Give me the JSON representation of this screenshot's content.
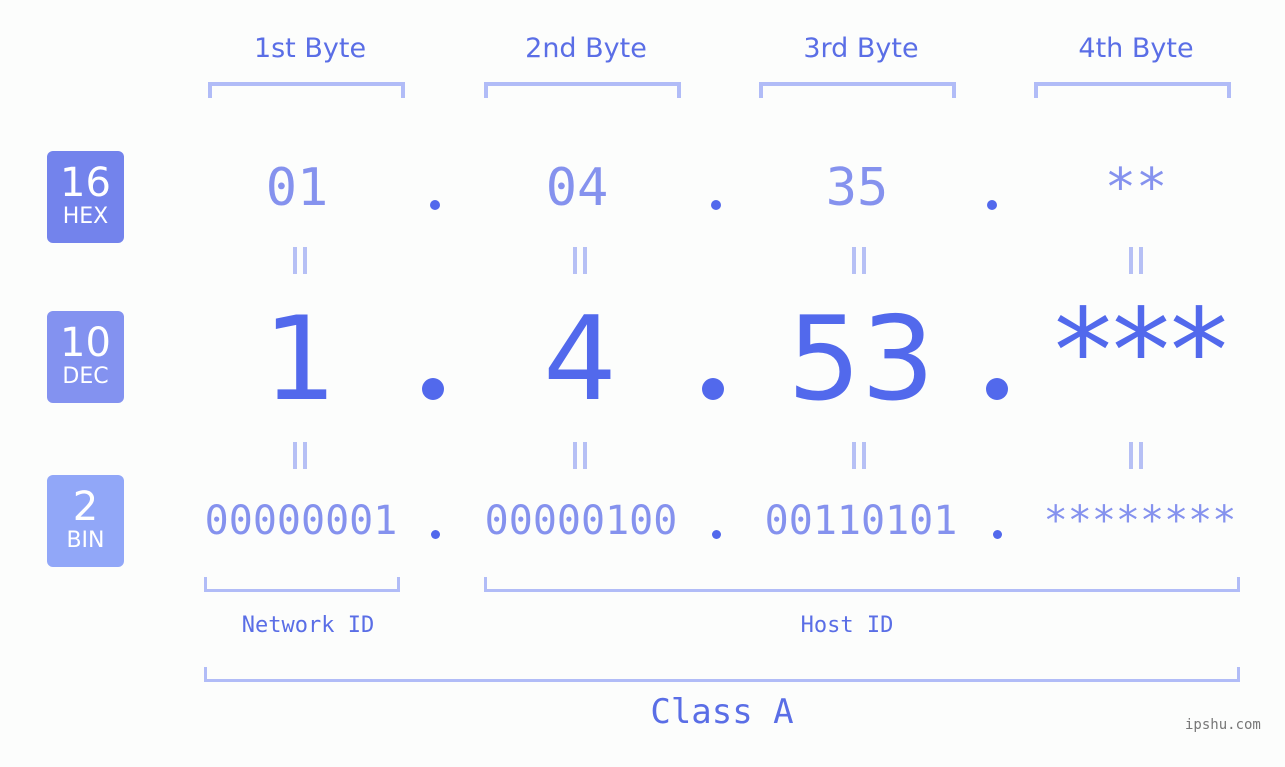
{
  "byte_headers": [
    "1st Byte",
    "2nd Byte",
    "3rd Byte",
    "4th Byte"
  ],
  "badges": [
    {
      "number": "16",
      "label": "HEX",
      "color": "#7383ec"
    },
    {
      "number": "10",
      "label": "DEC",
      "color": "#8392f0"
    },
    {
      "number": "2",
      "label": "BIN",
      "color": "#91a7f8"
    }
  ],
  "hex_values": [
    "01",
    "04",
    "35",
    "**"
  ],
  "dec_values": [
    "1",
    "4",
    "53",
    "***"
  ],
  "bin_values": [
    "00000001",
    "00000100",
    "00110101",
    "********"
  ],
  "separator": ".",
  "network_id_label": "Network ID",
  "host_id_label": "Host ID",
  "class_label": "Class A",
  "watermark": "ipshu.com",
  "colors": {
    "accent": "#5269ec",
    "light_value": "#8592ee",
    "bracket": "#b1bcf7",
    "background": "#fcfdfc"
  }
}
